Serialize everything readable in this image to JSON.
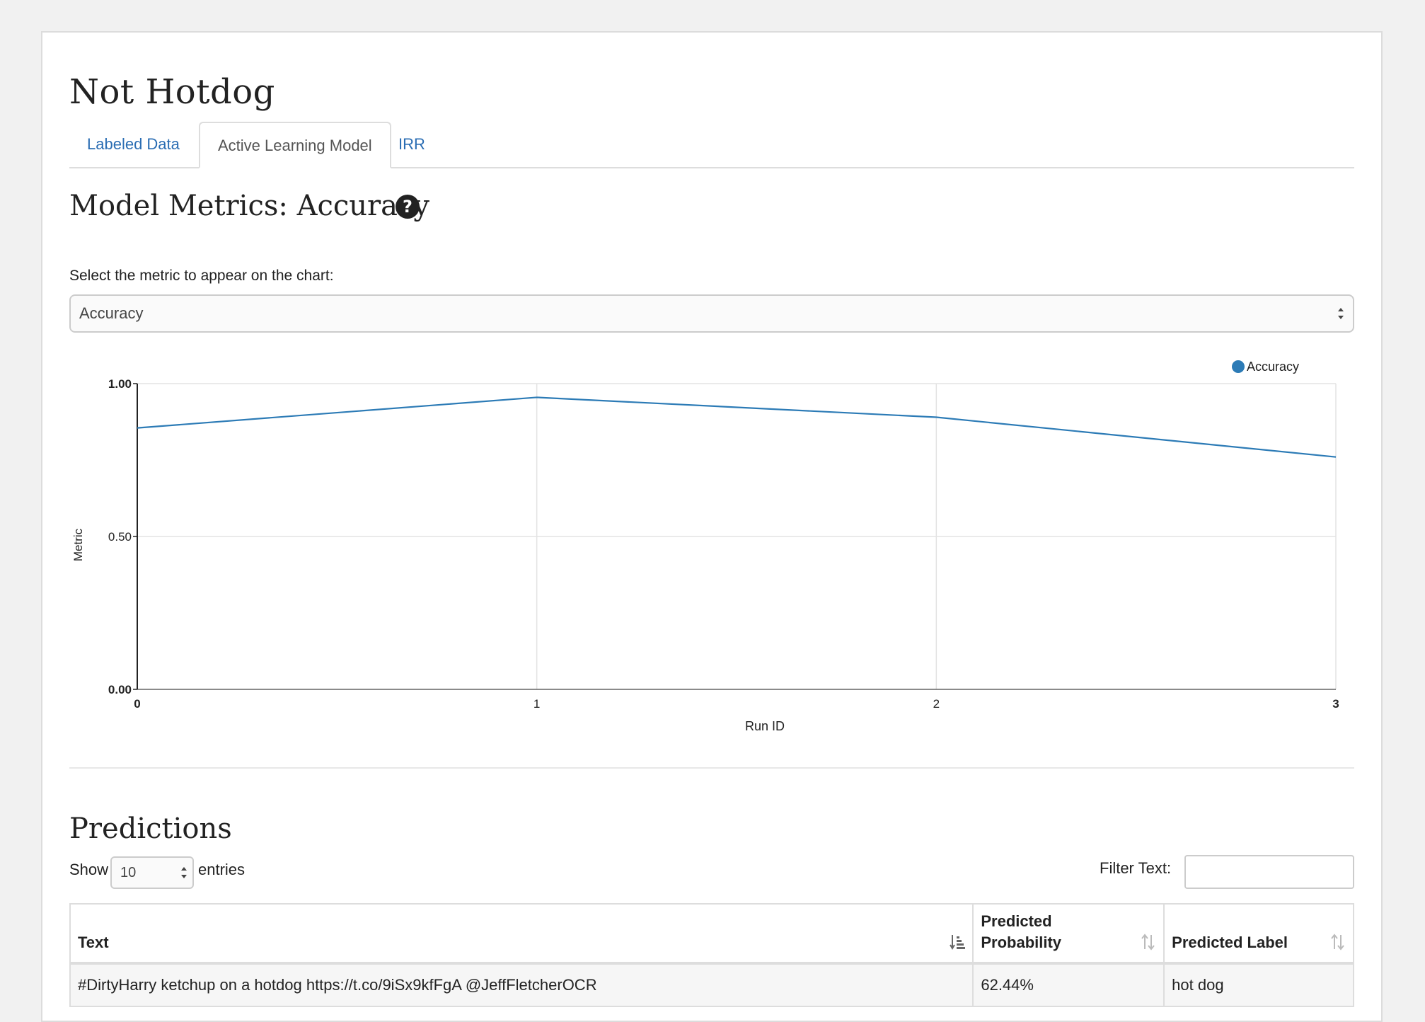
{
  "app_title": "Not Hotdog",
  "tabs": [
    {
      "label": "Labeled Data",
      "active": false
    },
    {
      "label": "Active Learning Model",
      "active": true
    },
    {
      "label": "IRR",
      "active": false
    }
  ],
  "metrics": {
    "title": "Model Metrics: Accuracy",
    "help_icon": "question-circle-icon",
    "select_label": "Select the metric to appear on the chart:",
    "selected_metric": "Accuracy"
  },
  "chart_data": {
    "type": "line",
    "xlabel": "Run ID",
    "ylabel": "Metric",
    "x": [
      0,
      1,
      2,
      3
    ],
    "x_tick_labels": [
      "0",
      "1",
      "2",
      "3"
    ],
    "y_tick_labels": [
      "0.00",
      "0.50",
      "1.00"
    ],
    "ylim": [
      0,
      1
    ],
    "xlim": [
      0,
      3
    ],
    "series": [
      {
        "name": "Accuracy",
        "values": [
          0.855,
          0.955,
          0.89,
          0.76
        ],
        "color": "#2c7bb6"
      }
    ],
    "legend_position": "top-right",
    "grid": true
  },
  "predictions": {
    "title": "Predictions",
    "show_label": "Show",
    "page_length": "10",
    "entries_label": "entries",
    "filter_label": "Filter Text:",
    "filter_value": "",
    "columns": [
      "Text",
      "Predicted Probability",
      "Predicted Label"
    ],
    "rows": [
      [
        "#DirtyHarry ketchup on a hotdog https://t.co/9iSx9kfFgA @JeffFletcherOCR",
        "62.44%",
        "hot dog"
      ]
    ]
  }
}
